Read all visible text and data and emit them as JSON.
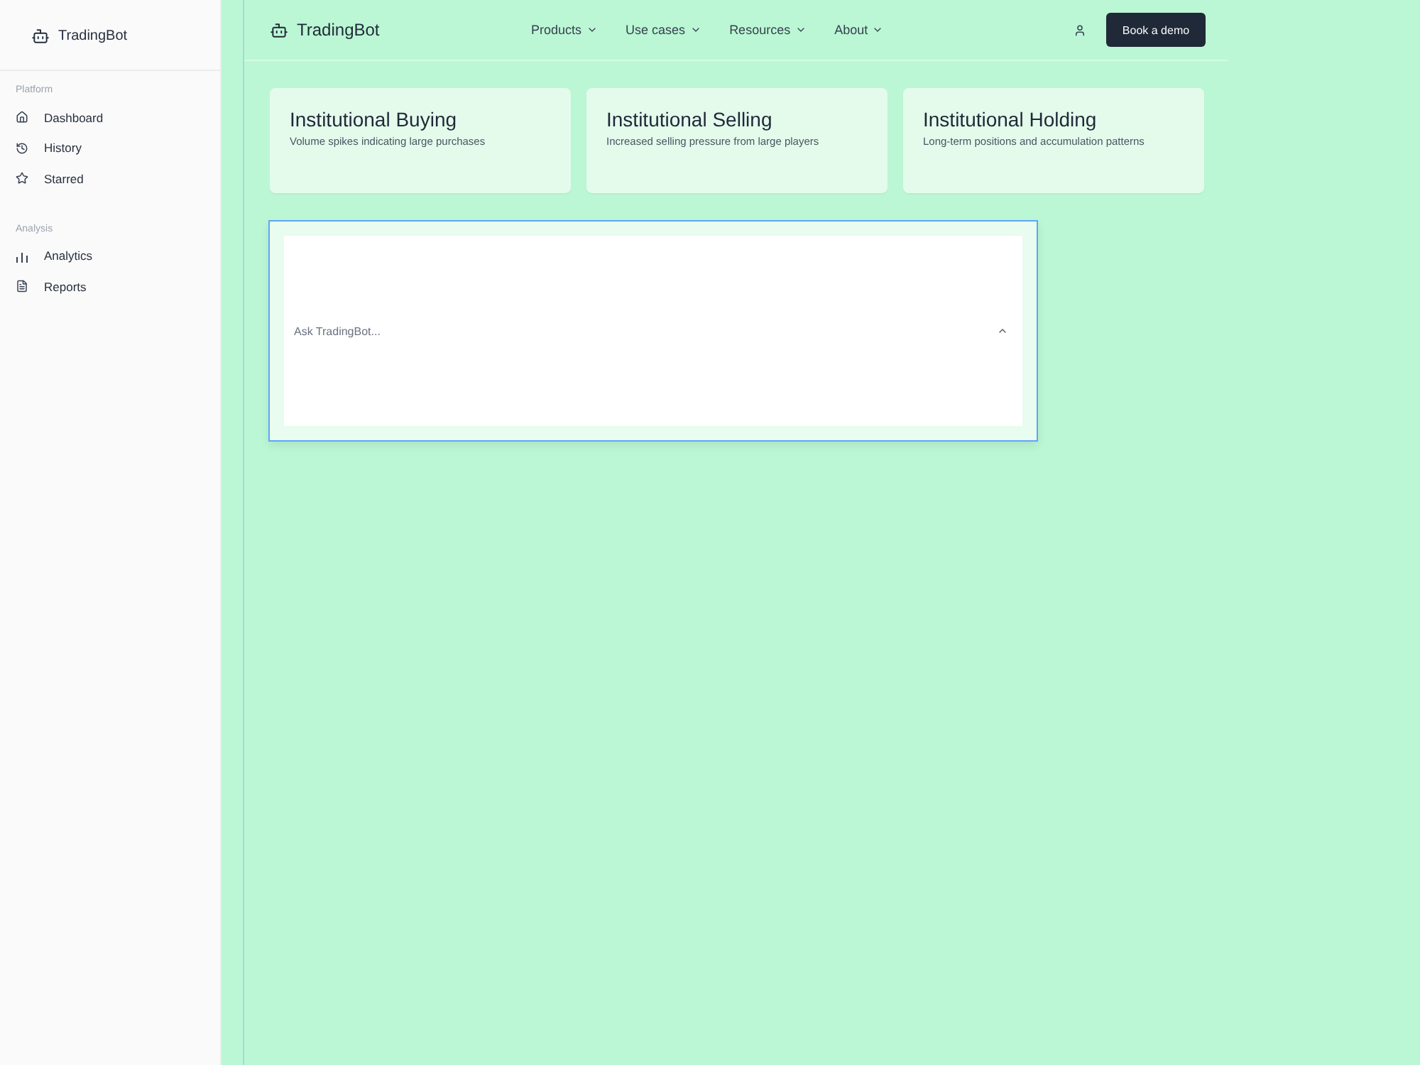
{
  "sidebar": {
    "brand": "TradingBot",
    "sections": [
      {
        "label": "Platform",
        "items": [
          {
            "label": "Dashboard"
          },
          {
            "label": "History"
          },
          {
            "label": "Starred"
          }
        ]
      },
      {
        "label": "Analysis",
        "items": [
          {
            "label": "Analytics"
          },
          {
            "label": "Reports"
          }
        ]
      }
    ]
  },
  "header": {
    "brand": "TradingBot",
    "nav": [
      {
        "label": "Products"
      },
      {
        "label": "Use cases"
      },
      {
        "label": "Resources"
      },
      {
        "label": "About"
      }
    ],
    "cta": "Book a demo"
  },
  "cards": [
    {
      "title": "Institutional Buying",
      "description": "Volume spikes indicating large purchases"
    },
    {
      "title": "Institutional Selling",
      "description": "Increased selling pressure from large players"
    },
    {
      "title": "Institutional Holding",
      "description": "Long-term positions and accumulation patterns"
    }
  ],
  "chat": {
    "placeholder": "Ask TradingBot..."
  }
}
